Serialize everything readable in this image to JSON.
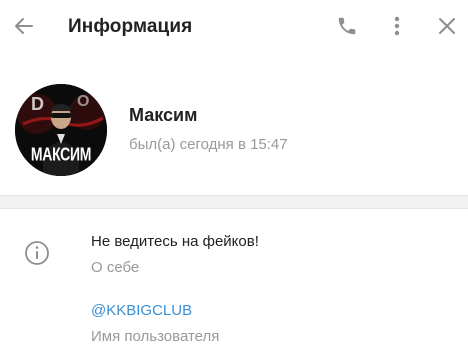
{
  "header": {
    "title": "Информация",
    "back_icon": "arrow-left-icon",
    "call_icon": "phone-icon",
    "more_icon": "more-vertical-icon",
    "close_icon": "close-icon"
  },
  "profile": {
    "name": "Максим",
    "status": "был(а) сегодня в 15:47",
    "avatar_caption": "МАКСИМ"
  },
  "info": {
    "icon": "info-icon",
    "bio": "Не ведитесь на фейков!",
    "bio_label": "О себе",
    "username": "@KKBIGCLUB",
    "username_label": "Имя пользователя"
  },
  "colors": {
    "accent": "#3a8fd4",
    "secondary_text": "#999999",
    "icon": "#8e8e8e",
    "divider": "#f1f1f1"
  }
}
